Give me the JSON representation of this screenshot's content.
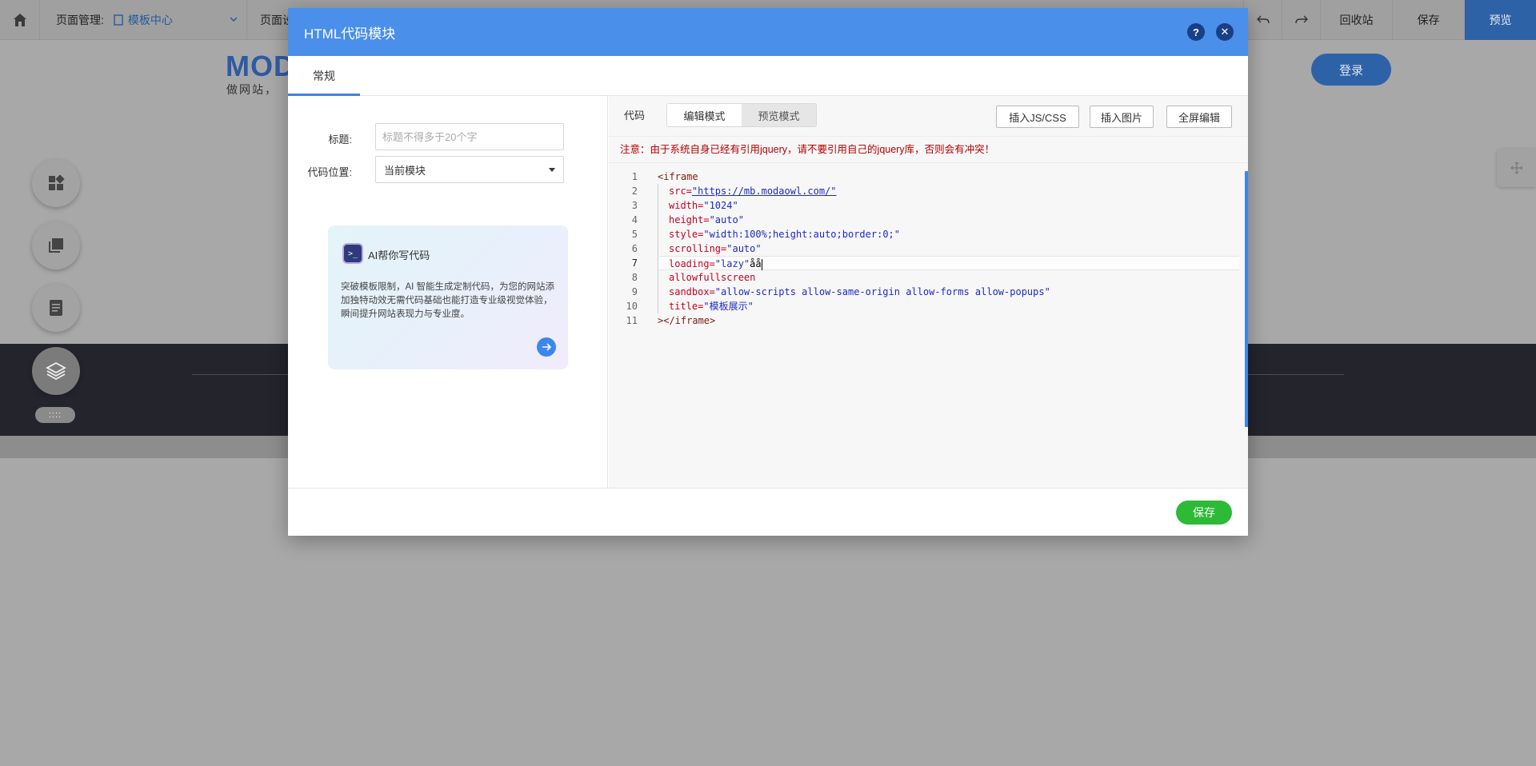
{
  "topbar": {
    "page_mgmt_label": "页面管理:",
    "template_center": "模板中心",
    "page_settings": "页面设",
    "recycle": "回收站",
    "save": "保存",
    "preview": "预览"
  },
  "background": {
    "logo": "MOD",
    "logo_sub": "做网站，",
    "login": "登录",
    "drag_dots": "::::"
  },
  "modal": {
    "title": "HTML代码模块",
    "help_glyph": "?",
    "close_glyph": "✕",
    "tab_general": "常规",
    "form": {
      "title_label": "标题:",
      "title_placeholder": "标题不得多于20个字",
      "position_label": "代码位置:",
      "position_value": "当前模块"
    },
    "ai_card": {
      "badge": ">_",
      "title": "AI帮你写代码",
      "description": "突破模板限制，AI 智能生成定制代码，为您的网站添加独特动效无需代码基础也能打造专业级视觉体验，瞬间提升网站表现力与专业度。"
    },
    "code_panel": {
      "label": "代码",
      "edit_mode": "编辑模式",
      "preview_mode": "预览模式",
      "insert_js_css": "插入JS/CSS",
      "insert_image": "插入图片",
      "fullscreen_edit": "全屏编辑",
      "notice": "注意：由于系统自身已经有引用jquery，请不要引用自己的jquery库，否则会有冲突！",
      "active_line": 7,
      "lines": [
        "1",
        "2",
        "3",
        "4",
        "5",
        "6",
        "7",
        "8",
        "9",
        "10",
        "11"
      ],
      "code": {
        "l1_open": "<iframe",
        "l2_attr": "src=",
        "l2_val": "\"https://mb.modaowl.com/\"",
        "l3_attr": "width=",
        "l3_val": "\"1024\"",
        "l4_attr": "height=",
        "l4_val": "\"auto\"",
        "l5_attr": "style=",
        "l5_val": "\"width:100%;height:auto;border:0;\"",
        "l6_attr": "scrolling=",
        "l6_val": "\"auto\"",
        "l7_attr": "loading=",
        "l7_val": "\"lazy\"",
        "l7_extra": "åå",
        "l8_attr": "allowfullscreen",
        "l9_attr": "sandbox=",
        "l9_val": "\"allow-scripts allow-same-origin allow-forms allow-popups\"",
        "l10_attr": "title=",
        "l10_val": "\"模板展示\"",
        "l11_close": "></iframe>"
      }
    },
    "footer_save": "保存"
  },
  "colors": {
    "header_blue": "#4a8fea",
    "accent_blue": "#3c83e0",
    "save_green": "#2dba36",
    "notice_red": "#b30000"
  }
}
